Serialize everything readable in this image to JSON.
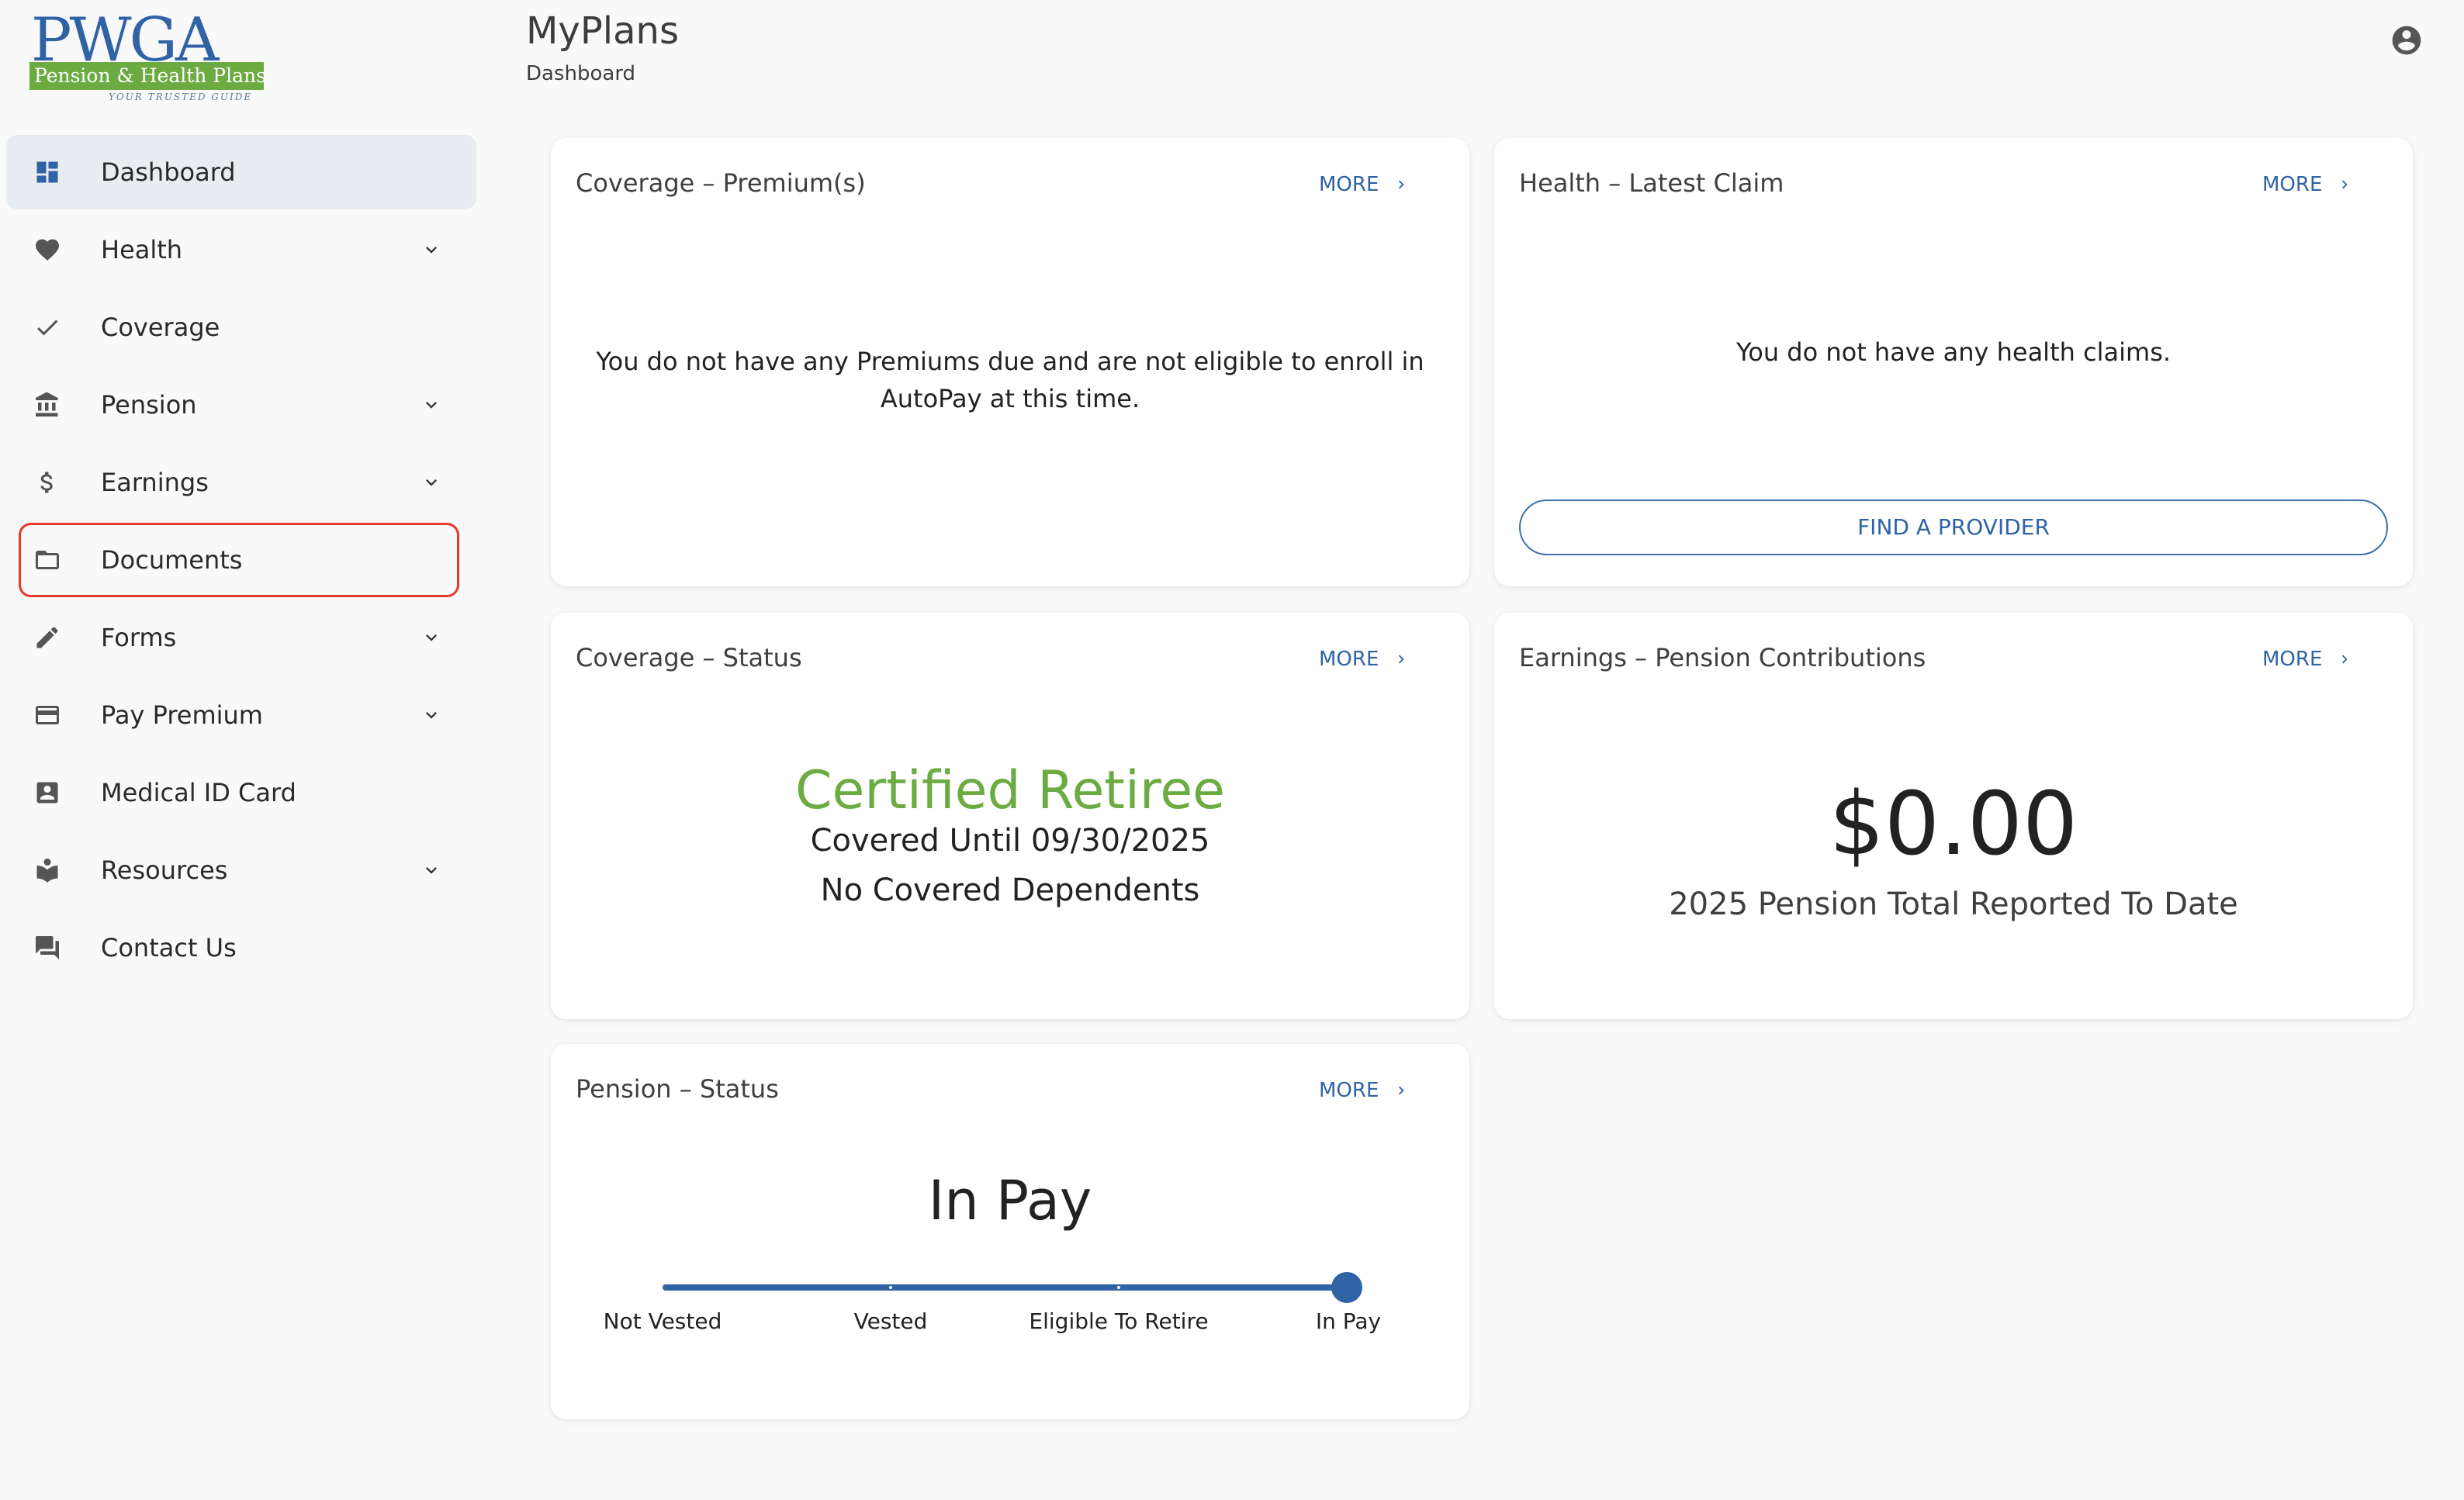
{
  "logo": {
    "main": "PWGA",
    "band": "Pension & Health Plans",
    "tagline": "YOUR TRUSTED GUIDE"
  },
  "header": {
    "title": "MyPlans",
    "breadcrumb": "Dashboard"
  },
  "nav": {
    "dashboard": "Dashboard",
    "health": "Health",
    "coverage": "Coverage",
    "pension": "Pension",
    "earnings": "Earnings",
    "documents": "Documents",
    "forms": "Forms",
    "pay_premium": "Pay Premium",
    "medical_id": "Medical ID Card",
    "resources": "Resources",
    "contact": "Contact Us"
  },
  "common": {
    "more": "MORE"
  },
  "cards": {
    "premiums": {
      "title": "Coverage – Premium(s)",
      "message_line1": "You do not have any Premiums due and are not eligible to enroll in",
      "message_line2": "AutoPay at this time."
    },
    "claim": {
      "title": "Health – Latest Claim",
      "message": "You do not have any health claims.",
      "button": "FIND A PROVIDER"
    },
    "coverage_status": {
      "title": "Coverage – Status",
      "status": "Certified Retiree",
      "covered_until": "Covered Until 09/30/2025",
      "dependents": "No Covered Dependents"
    },
    "contributions": {
      "title": "Earnings – Pension Contributions",
      "amount": "$0.00",
      "caption": "2025 Pension Total Reported To Date"
    },
    "pension_status": {
      "title": "Pension – Status",
      "status": "In Pay",
      "steps": [
        "Not Vested",
        "Vested",
        "Eligible To Retire",
        "In Pay"
      ],
      "current_step_index": 3
    }
  },
  "colors": {
    "accent_blue": "#2f63a6",
    "brand_green": "#6cab42",
    "highlight_red": "#e4392c"
  }
}
